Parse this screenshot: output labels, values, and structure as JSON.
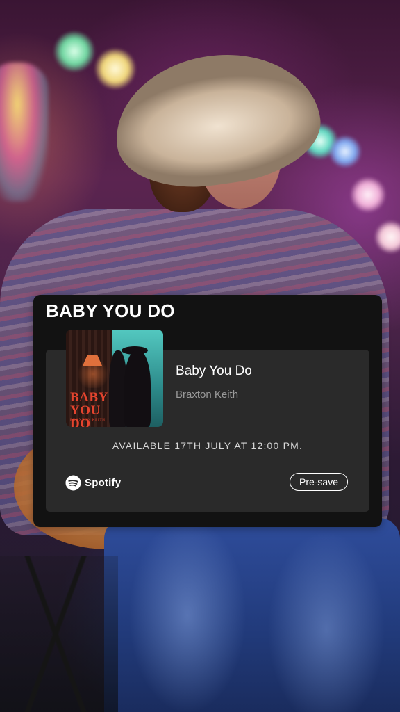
{
  "card": {
    "title": "BABY YOU DO"
  },
  "release": {
    "cover_title": "BABY YOU DO",
    "cover_artist": "BRAXTON KEITH",
    "track_title": "Baby You Do",
    "artist": "Braxton Keith",
    "availability": "AVAILABLE 17TH JULY AT 12:00 PM."
  },
  "platform": {
    "name": "Spotify",
    "icon": "spotify-icon"
  },
  "actions": {
    "presave_label": "Pre-save"
  },
  "colors": {
    "card_background": "#121212",
    "inner_background": "#2a2a2a",
    "text_primary": "#ffffff",
    "text_secondary": "#9a9a9a",
    "cover_accent": "#e4442e"
  }
}
